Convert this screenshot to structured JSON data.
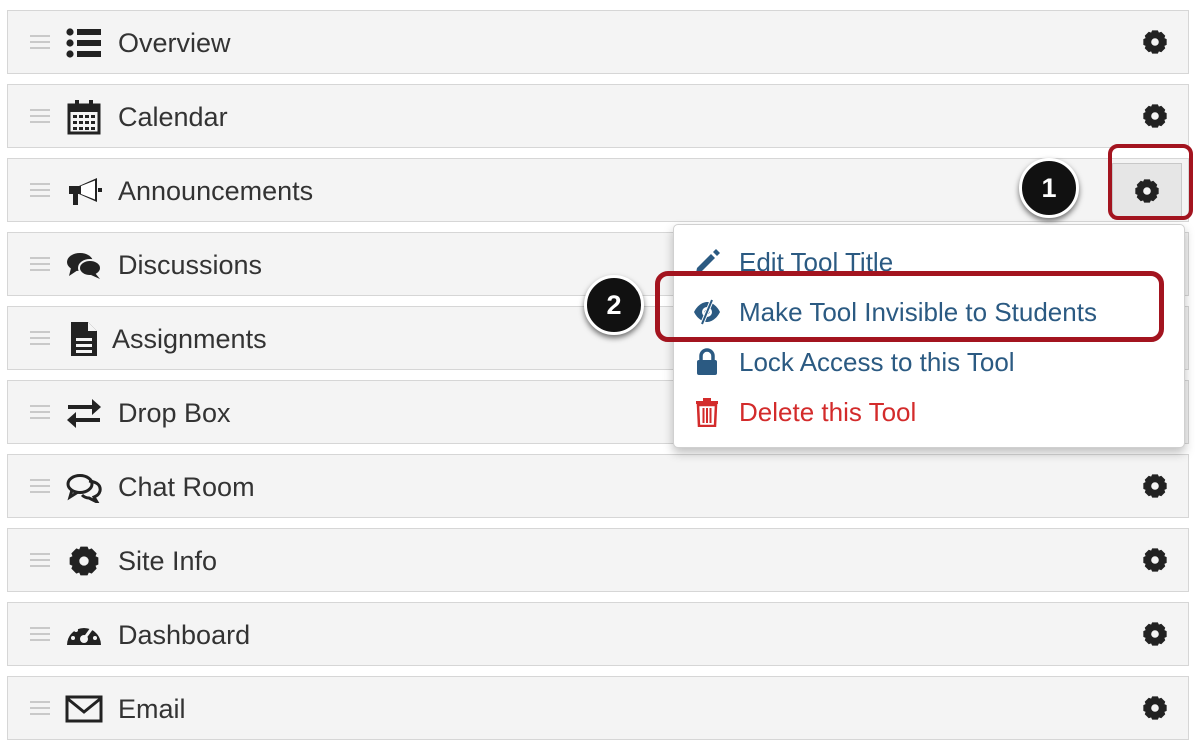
{
  "tools": [
    {
      "label": "Overview",
      "icon": "list-icon"
    },
    {
      "label": "Calendar",
      "icon": "calendar-icon"
    },
    {
      "label": "Announcements",
      "icon": "megaphone-icon"
    },
    {
      "label": "Discussions",
      "icon": "comments-icon"
    },
    {
      "label": "Assignments",
      "icon": "document-icon"
    },
    {
      "label": "Drop Box",
      "icon": "exchange-arrows-icon"
    },
    {
      "label": "Chat Room",
      "icon": "chat-bubbles-icon"
    },
    {
      "label": "Site Info",
      "icon": "gear-icon"
    },
    {
      "label": "Dashboard",
      "icon": "dashboard-gauge-icon"
    },
    {
      "label": "Email",
      "icon": "envelope-icon"
    }
  ],
  "dropdown": {
    "items": [
      {
        "label": "Edit Tool Title",
        "icon": "pencil-icon"
      },
      {
        "label": "Make Tool Invisible to Students",
        "icon": "eye-slash-icon"
      },
      {
        "label": "Lock Access to this Tool",
        "icon": "lock-icon"
      },
      {
        "label": "Delete this Tool",
        "icon": "trash-icon"
      }
    ]
  },
  "callouts": {
    "step1": "1",
    "step2": "2"
  },
  "colors": {
    "row_bg": "#f4f4f4",
    "menu_link": "#2b5a82",
    "menu_danger": "#d32b2b",
    "callout_red": "#a3141f",
    "badge_bg": "#111111"
  }
}
